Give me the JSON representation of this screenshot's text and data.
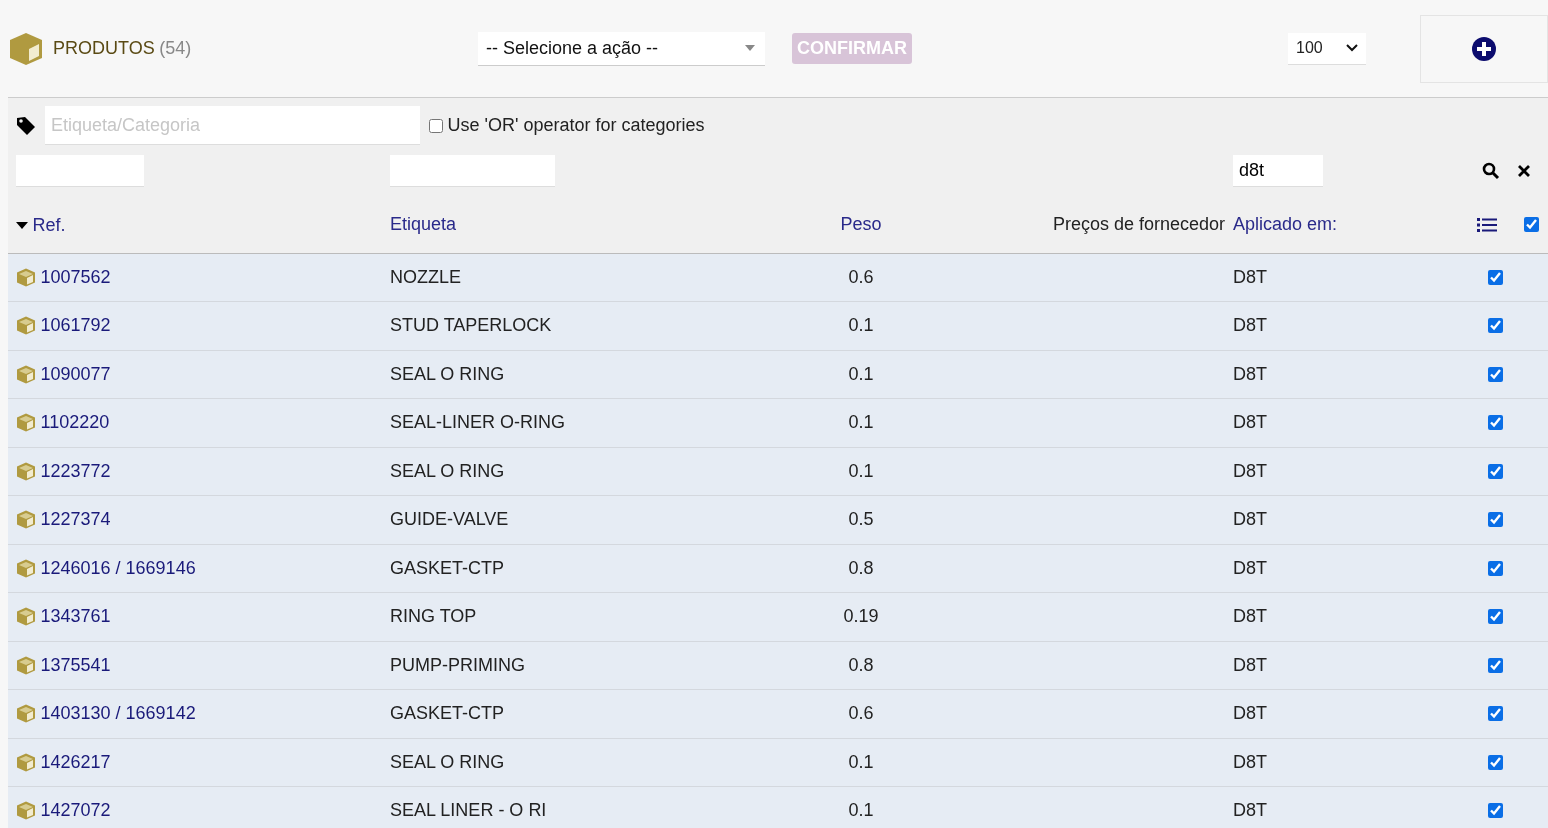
{
  "header": {
    "title": "PRODUTOS",
    "count": "(54)"
  },
  "action_select": {
    "value": "-- Selecione a ação --"
  },
  "confirm_button": {
    "label": "CONFIRMAR",
    "disabled": true
  },
  "page_size": {
    "value": "100"
  },
  "tag_filter": {
    "placeholder": "Etiqueta/Categoria"
  },
  "or_operator": {
    "label": "Use 'OR' operator for categories",
    "checked": false
  },
  "column_filters": {
    "aplicado_em": "d8t"
  },
  "columns": [
    {
      "label": "Ref.",
      "kind": "link",
      "sorted": true
    },
    {
      "label": "Etiqueta",
      "kind": "link",
      "sorted": false
    },
    {
      "label": "Peso",
      "kind": "link",
      "sorted": false
    },
    {
      "label": "Preços de fornecedor",
      "kind": "plain",
      "sorted": false
    },
    {
      "label": "Aplicado em:",
      "kind": "link",
      "sorted": false
    }
  ],
  "select_all": {
    "checked": true
  },
  "rows": [
    {
      "ref": "1007562",
      "label": "NOZZLE",
      "weight": "0.6",
      "applied": "D8T",
      "checked": true
    },
    {
      "ref": "1061792",
      "label": "STUD TAPERLOCK",
      "weight": "0.1",
      "applied": "D8T",
      "checked": true
    },
    {
      "ref": "1090077",
      "label": "SEAL O RING",
      "weight": "0.1",
      "applied": "D8T",
      "checked": true
    },
    {
      "ref": "1102220",
      "label": "SEAL-LINER O-RING",
      "weight": "0.1",
      "applied": "D8T",
      "checked": true
    },
    {
      "ref": "1223772",
      "label": "SEAL O RING",
      "weight": "0.1",
      "applied": "D8T",
      "checked": true
    },
    {
      "ref": "1227374",
      "label": "GUIDE-VALVE",
      "weight": "0.5",
      "applied": "D8T",
      "checked": true
    },
    {
      "ref": "1246016 / 1669146",
      "label": "GASKET-CTP",
      "weight": "0.8",
      "applied": "D8T",
      "checked": true
    },
    {
      "ref": "1343761",
      "label": "RING TOP",
      "weight": "0.19",
      "applied": "D8T",
      "checked": true
    },
    {
      "ref": "1375541",
      "label": "PUMP-PRIMING",
      "weight": "0.8",
      "applied": "D8T",
      "checked": true
    },
    {
      "ref": "1403130 / 1669142",
      "label": "GASKET-CTP",
      "weight": "0.6",
      "applied": "D8T",
      "checked": true
    },
    {
      "ref": "1426217",
      "label": "SEAL O RING",
      "weight": "0.1",
      "applied": "D8T",
      "checked": true
    },
    {
      "ref": "1427072",
      "label": "SEAL LINER - O RI",
      "weight": "0.1",
      "applied": "D8T",
      "checked": true
    }
  ]
}
